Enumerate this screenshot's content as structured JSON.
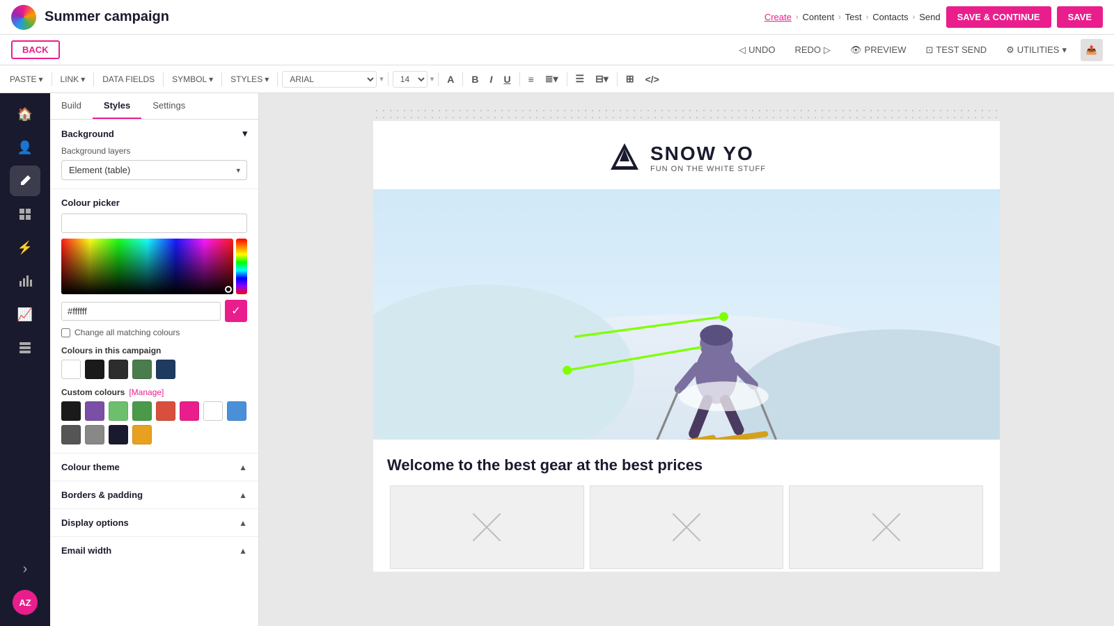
{
  "app": {
    "logo_alt": "App Logo",
    "campaign_title": "Summer campaign"
  },
  "breadcrumb": {
    "create": "Create",
    "content": "Content",
    "test": "Test",
    "contacts": "Contacts",
    "send": "Send"
  },
  "top_actions": {
    "save_continue": "SAVE & CONTINUE",
    "save": "SAVE"
  },
  "action_bar": {
    "back": "BACK",
    "undo": "UNDO",
    "redo": "REDO",
    "preview": "PREVIEW",
    "test_send": "TEST SEND",
    "utilities": "UTILITIES"
  },
  "toolbar": {
    "paste": "PASTE",
    "link": "LINK",
    "data_fields": "DATA FIELDS",
    "symbol": "SYMBOL",
    "styles": "STYLES",
    "font": "ARIAL",
    "size": "14",
    "bold": "B",
    "italic": "I",
    "underline": "U"
  },
  "left_nav": {
    "items": [
      {
        "id": "home",
        "icon": "🏠"
      },
      {
        "id": "users",
        "icon": "👤"
      },
      {
        "id": "edit",
        "icon": "✏️"
      },
      {
        "id": "grid",
        "icon": "▦"
      },
      {
        "id": "lightning",
        "icon": "⚡"
      },
      {
        "id": "chart",
        "icon": "📊"
      },
      {
        "id": "analytics",
        "icon": "📈"
      },
      {
        "id": "blocks",
        "icon": "⊞"
      }
    ],
    "avatar": "AZ",
    "expand_icon": "›"
  },
  "panel": {
    "tabs": [
      "Build",
      "Styles",
      "Settings"
    ],
    "active_tab": "Styles",
    "background": {
      "label": "Background",
      "expanded": true
    },
    "background_layers": {
      "label": "Background layers",
      "selected": "Element (table)"
    },
    "colour_picker": {
      "label": "Colour picker",
      "hex_value": "#ffffff",
      "change_matching": "Change all matching colours"
    },
    "colours_in_campaign": {
      "label": "Colours in this campaign",
      "swatches": [
        "#ffffff",
        "#1a1a1a",
        "#2d2d2d",
        "#4a7c4e",
        "#1f3a5f"
      ]
    },
    "custom_colours": {
      "label": "Custom colours",
      "manage": "[Manage]",
      "swatches": [
        "#1a1a1a",
        "#7b4fa6",
        "#6dbf6d",
        "#4a9a4a",
        "#d94f3d",
        "#e91e8c",
        "#ffffff",
        "#4a90d9",
        "#555555",
        "#888888",
        "#1a1a2e",
        "#e8a020"
      ]
    },
    "colour_theme": {
      "label": "Colour theme",
      "expanded": false
    },
    "borders_padding": {
      "label": "Borders & padding",
      "expanded": false
    },
    "display_options": {
      "label": "Display options",
      "expanded": false
    },
    "email_width": {
      "label": "Email width",
      "expanded": false
    }
  },
  "canvas": {
    "logo_name": "SNOW YO",
    "logo_tagline": "FUN ON THE WHITE STUFF",
    "welcome_text": "Welcome to the best gear at the best prices"
  }
}
